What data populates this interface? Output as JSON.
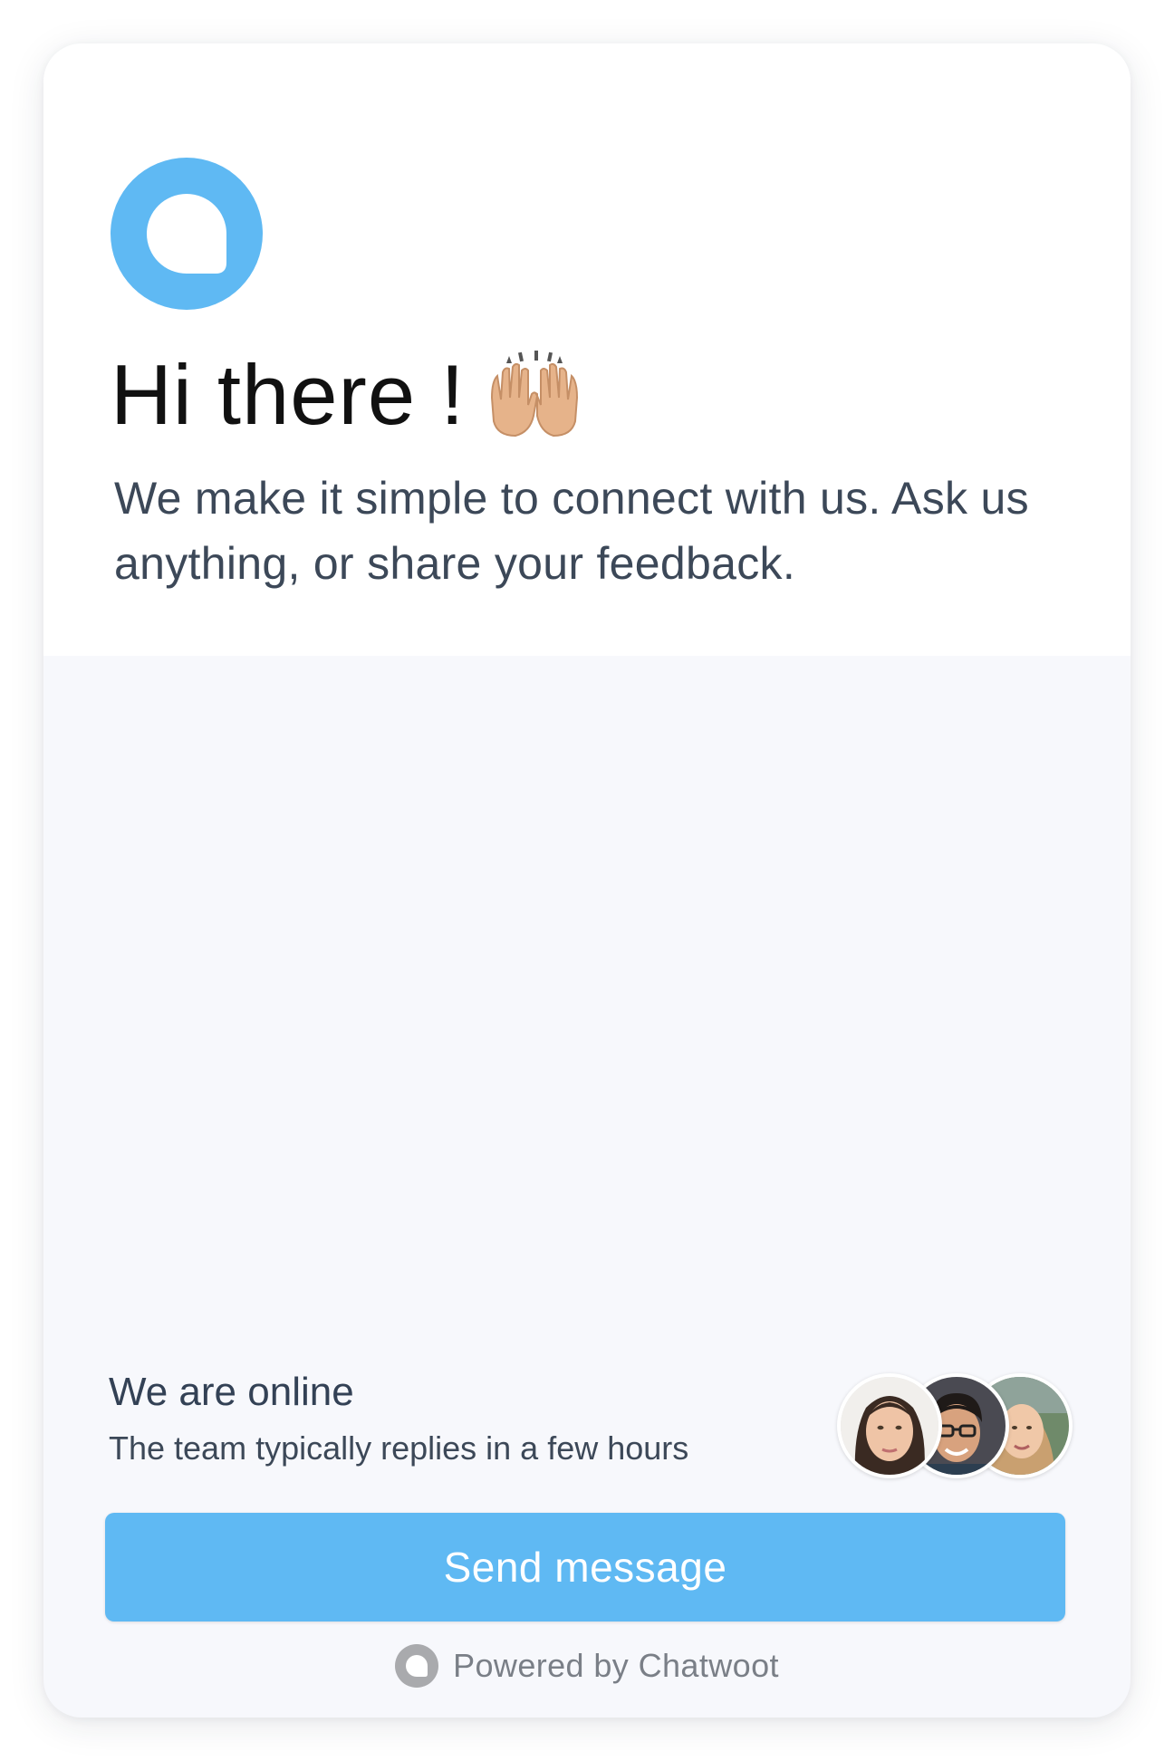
{
  "brand": {
    "accent_color": "#5fb9f3",
    "logo_icon": "chatwoot-logo-icon"
  },
  "header": {
    "greeting": "Hi there !",
    "greeting_emoji": "raising-hands-icon",
    "intro": "We make it simple to connect with us. Ask us anything, or share your feedback."
  },
  "status": {
    "title": "We are online",
    "subtitle": "The team typically replies in a few hours"
  },
  "agents": [
    {
      "avatar": "agent-avatar-woman-dark-hair"
    },
    {
      "avatar": "agent-avatar-man-glasses"
    },
    {
      "avatar": "agent-avatar-woman-blonde"
    }
  ],
  "actions": {
    "send_label": "Send message"
  },
  "footer": {
    "branding": "Powered by Chatwoot",
    "branding_icon": "chatwoot-logo-icon"
  }
}
